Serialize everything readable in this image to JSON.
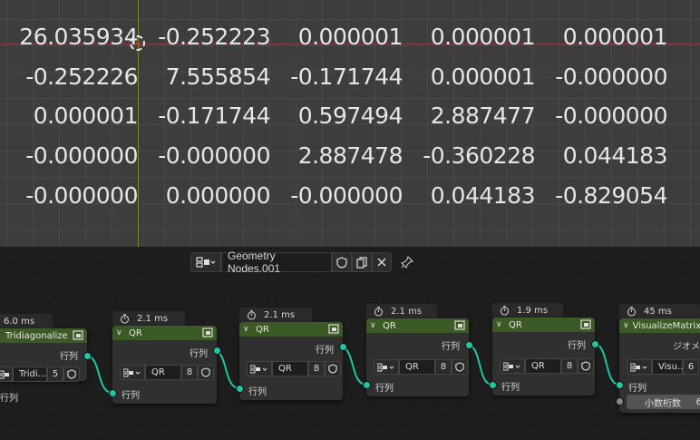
{
  "viewport": {
    "matrix": [
      [
        "26.035934",
        "-0.252223",
        "0.000001",
        "0.000001",
        "0.000001"
      ],
      [
        "-0.252226",
        "7.555854",
        "-0.171744",
        "0.000001",
        "-0.000000"
      ],
      [
        "0.000001",
        "-0.171744",
        "0.597494",
        "2.887477",
        "-0.000000"
      ],
      [
        "-0.000000",
        "-0.000000",
        "2.887478",
        "-0.360228",
        "0.044183"
      ],
      [
        "-0.000000",
        "0.000000",
        "-0.000000",
        "0.044183",
        "-0.829054"
      ]
    ]
  },
  "editor": {
    "tree_name": "Geometry Nodes.001",
    "icons": [
      "node-tree-icon",
      "chevron-down-icon",
      "shield-icon",
      "duplicate-icon",
      "close-icon",
      "pin-icon"
    ],
    "accent_colors": {
      "node_header": "#3b5a26",
      "matrix_socket": "#1fc6a4",
      "x_axis": "#8c3f46",
      "y_axis": "#6f8b32"
    }
  },
  "nodes": [
    {
      "timing": "6.0 ms",
      "title": "Tridiagonalize",
      "output": "行列",
      "group_name": "Tridi...",
      "users": "5",
      "input": "行列"
    },
    {
      "timing": "2.1 ms",
      "title": "QR",
      "output": "行列",
      "group_name": "QR",
      "users": "8",
      "input": "行列"
    },
    {
      "timing": "2.1 ms",
      "title": "QR",
      "output": "行列",
      "group_name": "QR",
      "users": "8",
      "input": "行列"
    },
    {
      "timing": "2.1 ms",
      "title": "QR",
      "output": "行列",
      "group_name": "QR",
      "users": "8",
      "input": "行列"
    },
    {
      "timing": "1.9 ms",
      "title": "QR",
      "output": "行列",
      "group_name": "QR",
      "users": "8",
      "input": "行列"
    },
    {
      "timing": "45 ms",
      "title": "VisualizeMatrix",
      "output": "ジオメ",
      "group_name": "Visu...",
      "users": "6",
      "input": "行列",
      "field_label": "小数桁数",
      "field_value": "6"
    }
  ]
}
